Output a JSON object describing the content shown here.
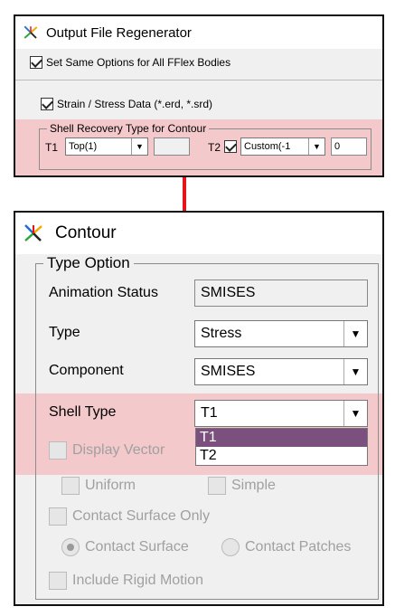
{
  "output_dialog": {
    "title": "Output File Regenerator",
    "same_options_label": "Set Same Options for All FFlex Bodies",
    "strain_stress_label": "Strain / Stress Data (*.erd, *.srd)",
    "group_title": "Shell Recovery Type for Contour",
    "t1_label": "T1",
    "t1_value": "Top(1)",
    "t1_extra_value": "",
    "t2_label": "T2",
    "t2_value": "Custom(-1",
    "t2_number": "0"
  },
  "contour_dialog": {
    "title": "Contour",
    "group_title": "Type Option",
    "animation_status_label": "Animation Status",
    "animation_status_value": "SMISES",
    "type_label": "Type",
    "type_value": "Stress",
    "component_label": "Component",
    "component_value": "SMISES",
    "shell_type_label": "Shell Type",
    "shell_type_value": "T1",
    "shell_type_options": [
      "T1",
      "T2"
    ],
    "display_vector_label": "Display Vector",
    "uniform_label": "Uniform",
    "simple_label": "Simple",
    "contact_surface_only_label": "Contact Surface Only",
    "contact_surface_label": "Contact Surface",
    "contact_patches_label": "Contact Patches",
    "include_rigid_motion_label": "Include Rigid Motion"
  },
  "colors": {
    "highlight": "#f4c9cb",
    "arrow": "#e8141c",
    "selected_option": "#7b4f7e"
  }
}
